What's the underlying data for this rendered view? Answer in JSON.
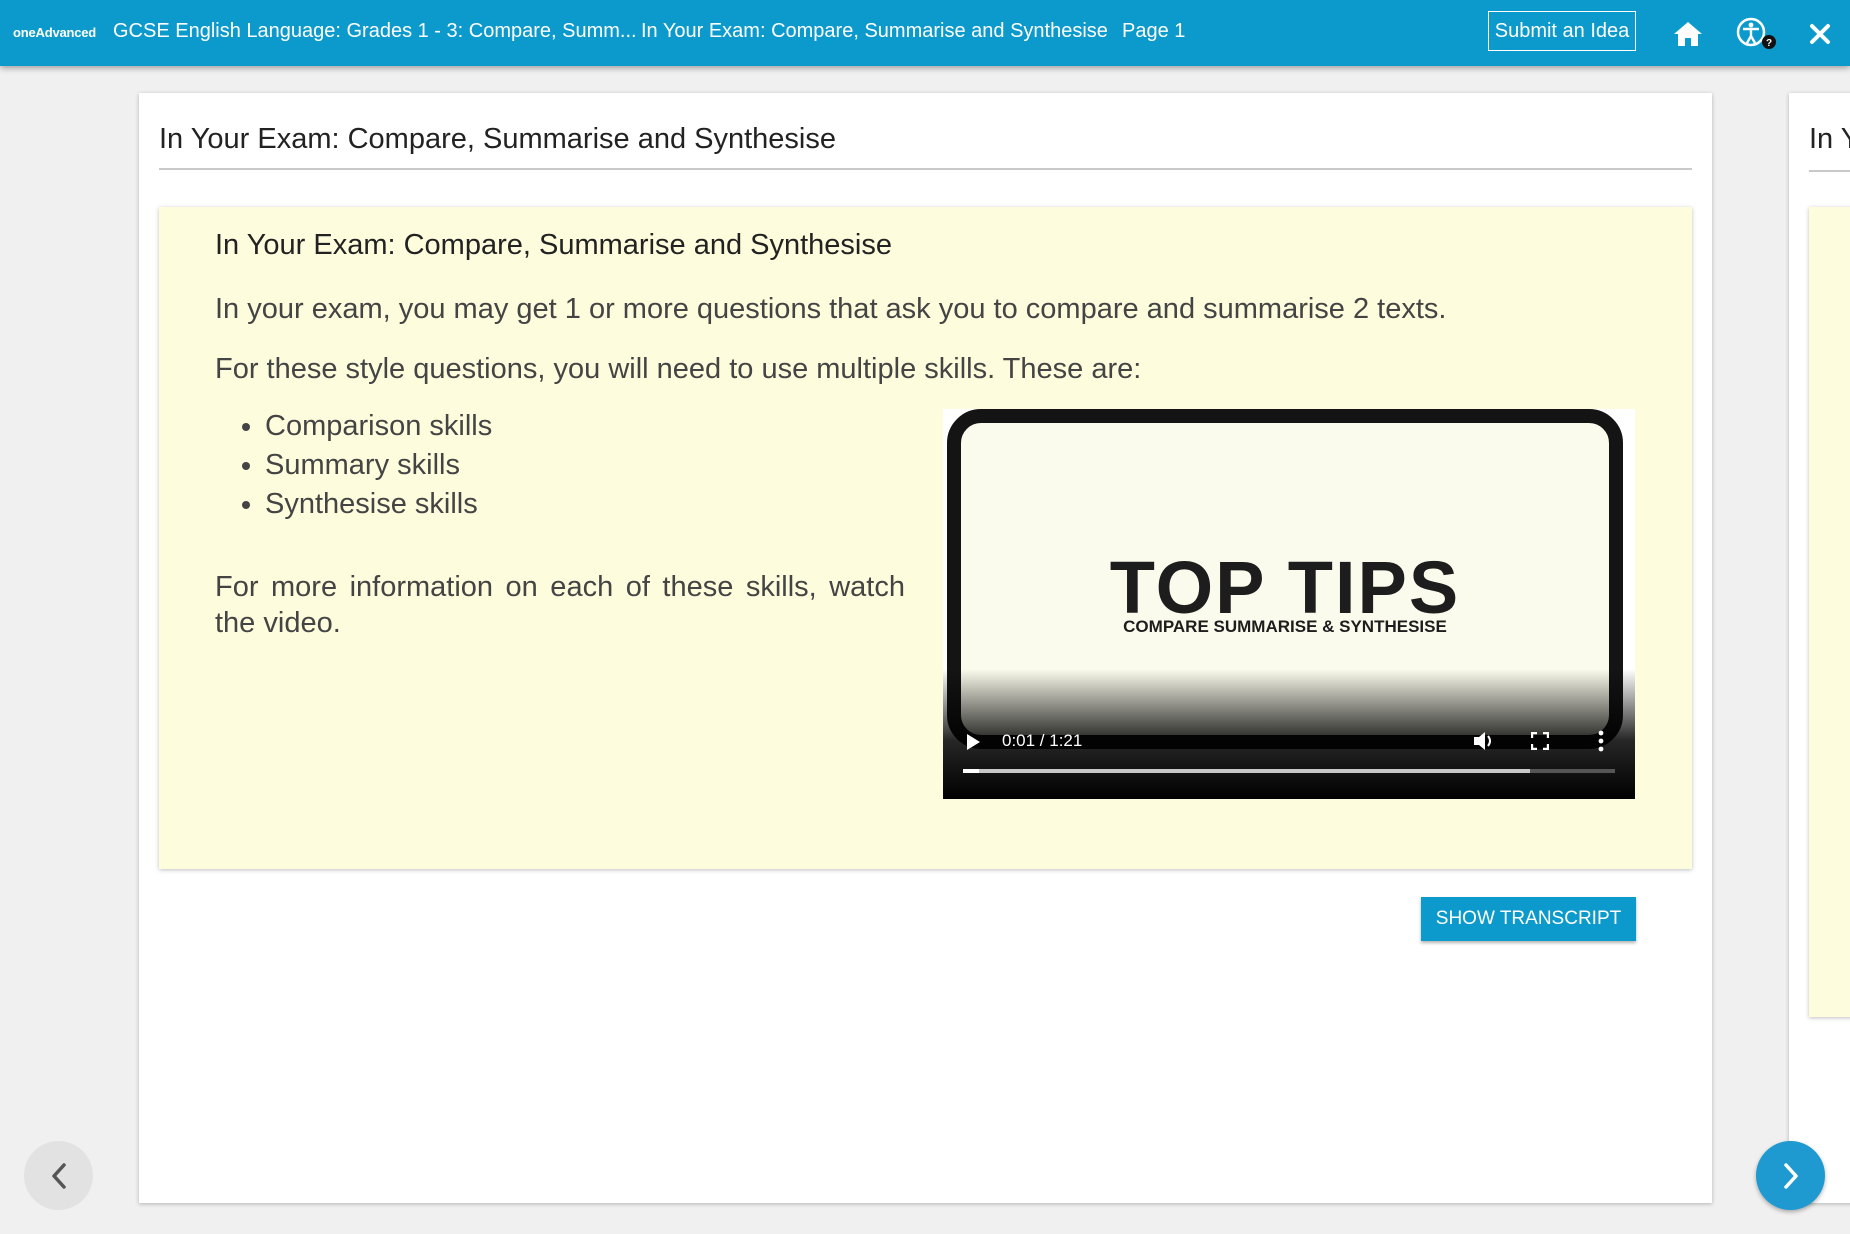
{
  "topbar": {
    "logo": "oneAdvanced",
    "course_title": "GCSE English Language: Grades 1 - 3: Compare, Summ...",
    "lesson_title": "In Your Exam: Compare, Summarise and Synthesise",
    "page_label": "Page 1",
    "submit_label": "Submit an Idea",
    "accent_color": "#0b9acb"
  },
  "card": {
    "title": "In Your Exam: Compare, Summarise and Synthesise",
    "panel": {
      "heading": "In Your Exam: Compare, Summarise and Synthesise",
      "para1": "In your exam, you may get 1 or more questions that ask you to compare and summarise 2 texts.",
      "para2": "For these style questions, you will need to use multiple skills. These are:",
      "skills": [
        "Comparison skills",
        "Summary skills",
        "Synthesise skills"
      ],
      "para3": "For more information on each of these skills, watch the video.",
      "background_color": "#fdfcdc"
    },
    "video": {
      "title": "TOP TIPS",
      "subtitle": "COMPARE SUMMARISE & SYNTHESISE",
      "time": "0:01 / 1:21",
      "progress_fraction": 0.01,
      "buffered_fraction": 0.87
    },
    "transcript_label": "SHOW TRANSCRIPT"
  },
  "next_card": {
    "title_peek": "In Y"
  }
}
